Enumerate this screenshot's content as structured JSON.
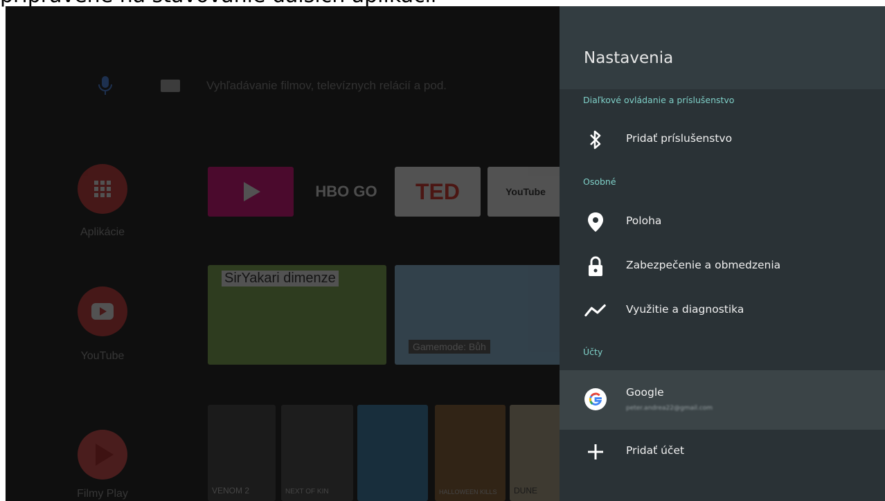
{
  "caption": "pripravené na stavovanie ďalších aplikácií",
  "home": {
    "search_placeholder": "Vyhľadávanie filmov, televíznych relácií a pod.",
    "rail": [
      {
        "label": "Aplikácie",
        "icon": "apps-grid-icon",
        "color": "#d32f2f"
      },
      {
        "label": "YouTube",
        "icon": "youtube-play-icon",
        "color": "#d32f2f"
      },
      {
        "label": "Filmy Play",
        "icon": "play-movies-icon",
        "color": "#d32f2f"
      }
    ],
    "app_tiles": [
      "HBO GO",
      "TED",
      "YouTube"
    ],
    "video_tiles": [
      "SirYakari dimenze",
      "Gamemode: Bůh"
    ],
    "movie_posters": [
      "VENOM 2",
      "NEXT OF KIN",
      "",
      "HALLOWEEN KILLS",
      "DUNE"
    ]
  },
  "settings": {
    "title": "Nastavenia",
    "sections": [
      {
        "header": "Diaľkové ovládanie a príslušenstvo",
        "items": [
          {
            "label": "Pridať príslušenstvo",
            "icon": "bluetooth-icon"
          }
        ]
      },
      {
        "header": "Osobné",
        "items": [
          {
            "label": "Poloha",
            "icon": "location-pin-icon"
          },
          {
            "label": "Zabezpečenie a obmedzenia",
            "icon": "lock-icon"
          },
          {
            "label": "Využitie a diagnostika",
            "icon": "diagnostics-icon"
          }
        ]
      },
      {
        "header": "Účty",
        "items": [
          {
            "label": "Google",
            "icon": "google-icon",
            "sublabel": "peter.andrea22@gmail.com",
            "selected": true
          },
          {
            "label": "Pridať účet",
            "icon": "plus-icon"
          }
        ]
      }
    ]
  },
  "colors": {
    "panel": "#2a3236",
    "panel_header": "#333d41",
    "section_header": "#7fd0c8",
    "selected_row": "#3b4447"
  }
}
